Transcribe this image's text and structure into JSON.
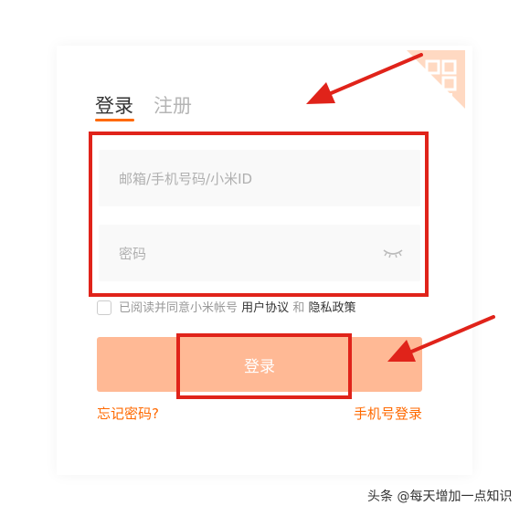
{
  "tabs": {
    "login": "登录",
    "register": "注册"
  },
  "form": {
    "account_placeholder": "邮箱/手机号码/小米ID",
    "password_placeholder": "密码"
  },
  "agreement": {
    "prefix": "已阅读并同意小米帐号",
    "user_agreement": "用户协议",
    "and": "和",
    "privacy_policy": "隐私政策"
  },
  "buttons": {
    "login": "登录",
    "forgot_password": "忘记密码?",
    "phone_login": "手机号登录"
  },
  "watermark": "头条 @每天增加一点知识",
  "colors": {
    "accent": "#ff6900",
    "button_bg": "#ffb995",
    "annotation_red": "#e0231a"
  },
  "icons": [
    "qr-code-icon",
    "eye-closed-icon",
    "annotation-arrow"
  ]
}
